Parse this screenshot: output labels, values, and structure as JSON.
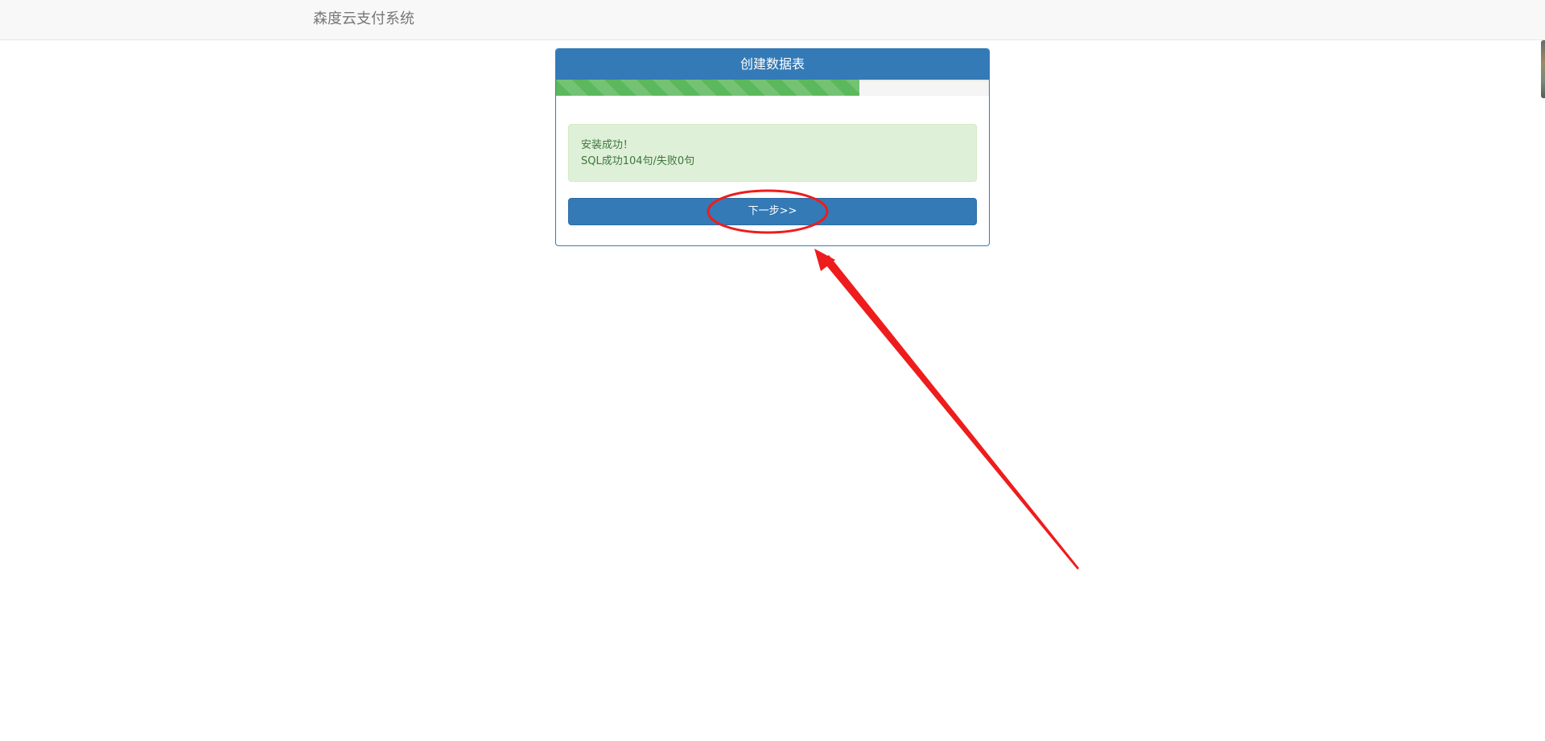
{
  "navbar": {
    "brand": "森度云支付系统"
  },
  "panel": {
    "title": "创建数据表",
    "progress_fraction": 0.7,
    "progress_color": "#5cb85c",
    "alert": {
      "line1": "安装成功！",
      "line2": "SQL成功104句/失败0句"
    },
    "next_button_label": "下一步>>"
  },
  "colors": {
    "primary": "#337ab7",
    "success_bg": "#dff0d8",
    "success_text": "#3c763d",
    "annotation_red": "#ee1c1c"
  }
}
